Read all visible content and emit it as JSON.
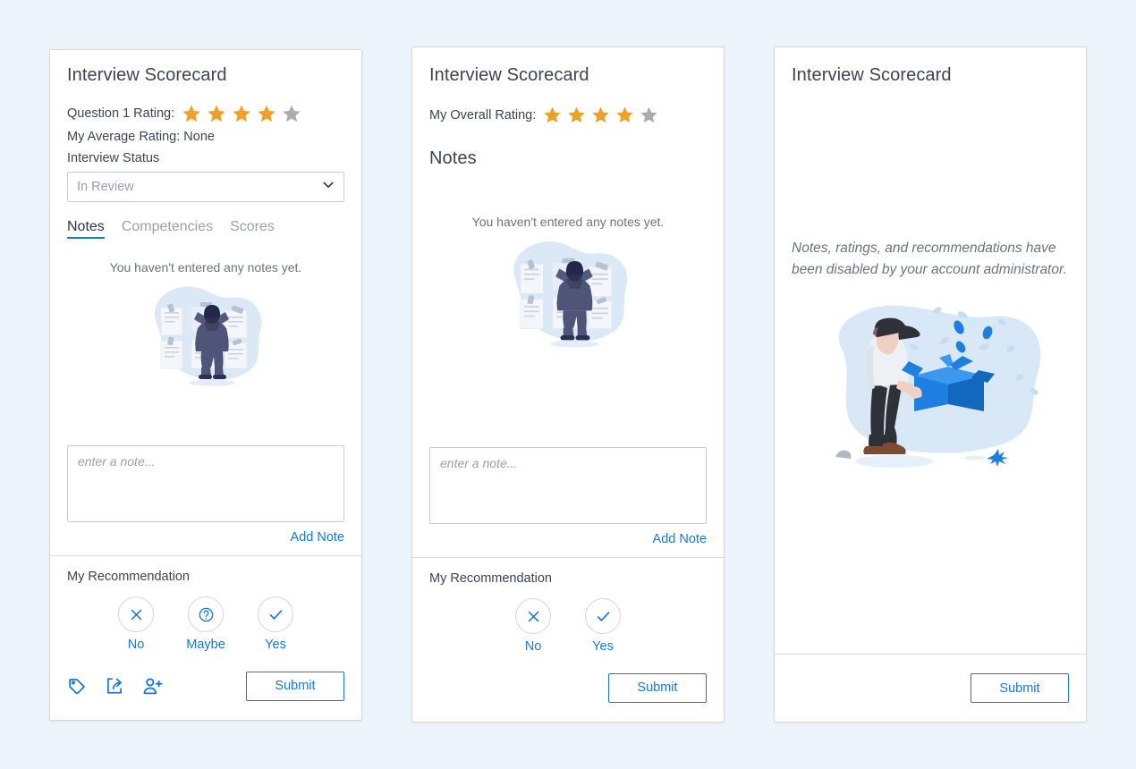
{
  "page": {
    "background_color": "#edf4fc",
    "accent_color": "#1679d4",
    "star_on_color": "#f0a028",
    "star_off_color": "#a9adb3"
  },
  "card1": {
    "title": "Interview Scorecard",
    "rating_label": "Question 1 Rating:",
    "stars_filled": 4,
    "stars_total": 5,
    "average_rating": "My Average Rating: None",
    "status_field_label": "Interview Status",
    "status_value": "In Review",
    "status_options": [
      "In Review"
    ],
    "tabs": [
      {
        "label": "Notes",
        "active": true
      },
      {
        "label": "Competencies",
        "active": false
      },
      {
        "label": "Scores",
        "active": false
      }
    ],
    "empty_notes_text": "You haven't entered any notes yet.",
    "note_placeholder": "enter a note...",
    "note_value": "",
    "add_note_label": "Add Note",
    "recommendation_title": "My Recommendation",
    "recommendations": [
      {
        "label": "No",
        "icon": "close-icon"
      },
      {
        "label": "Maybe",
        "icon": "question-circle-icon"
      },
      {
        "label": "Yes",
        "icon": "check-icon"
      }
    ],
    "footer_icons": [
      "tag-icon",
      "share-icon",
      "add-person-icon"
    ],
    "submit_label": "Submit"
  },
  "card2": {
    "title": "Interview Scorecard",
    "rating_label": "My Overall Rating:",
    "stars_filled": 4,
    "stars_total": 5,
    "notes_heading": "Notes",
    "empty_notes_text": "You haven't entered any notes yet.",
    "note_placeholder": "enter a note...",
    "note_value": "",
    "add_note_label": "Add Note",
    "recommendation_title": "My Recommendation",
    "recommendations": [
      {
        "label": "No",
        "icon": "close-icon"
      },
      {
        "label": "Yes",
        "icon": "check-icon"
      }
    ],
    "submit_label": "Submit"
  },
  "card3": {
    "title": "Interview Scorecard",
    "disabled_message": "Notes, ratings, and recommendations have been disabled by your account administrator.",
    "illustration": "person-with-box-illustration",
    "submit_label": "Submit"
  }
}
